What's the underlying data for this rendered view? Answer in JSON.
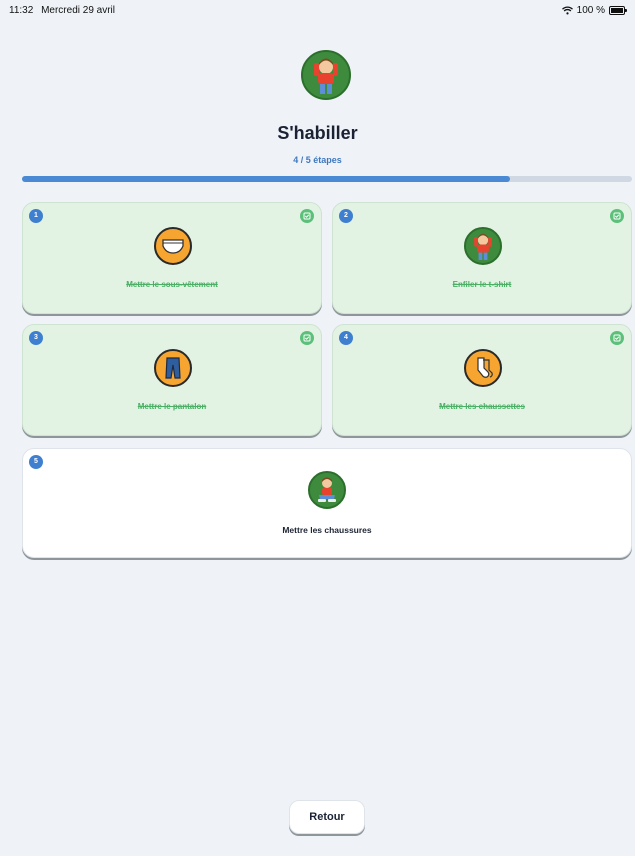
{
  "status_bar": {
    "time": "11:32",
    "date": "Mercredi 29 avril",
    "battery": "100 %",
    "icons": [
      "wifi-icon",
      "battery-icon"
    ]
  },
  "routine": {
    "title": "S'habiller",
    "progress_label": "4 / 5 étapes",
    "progress_fraction": 0.8
  },
  "steps": [
    {
      "number": "1",
      "label": "Mettre le sous-vêtement",
      "done": true,
      "icon": "underwear-icon"
    },
    {
      "number": "2",
      "label": "Enfiler le t-shirt",
      "done": true,
      "icon": "tshirt-child-icon"
    },
    {
      "number": "3",
      "label": "Mettre le pantalon",
      "done": true,
      "icon": "pants-icon"
    },
    {
      "number": "4",
      "label": "Mettre les chaussettes",
      "done": true,
      "icon": "socks-icon"
    },
    {
      "number": "5",
      "label": "Mettre les chaussures",
      "done": false,
      "icon": "shoes-child-icon"
    }
  ],
  "footer": {
    "back_label": "Retour"
  },
  "colors": {
    "accent": "#4a8ad5",
    "done_card": "#e2f3e4",
    "done_text": "#4caf66",
    "check": "#5cc07a"
  }
}
